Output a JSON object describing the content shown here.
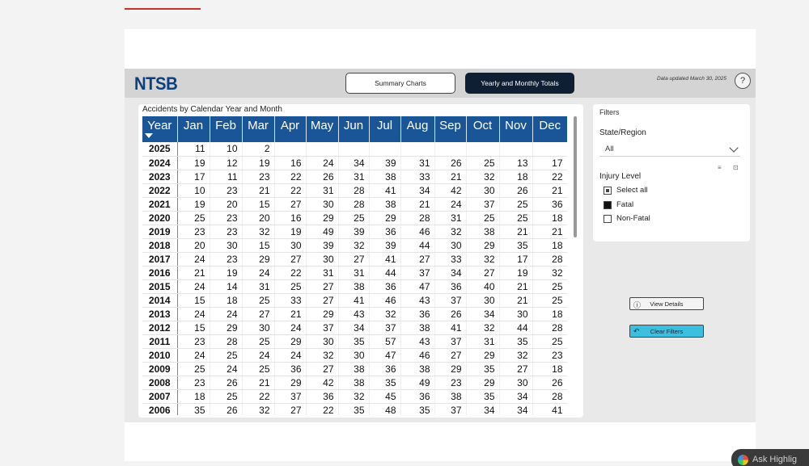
{
  "header": {
    "logo": "NTSB",
    "summary_button": "Summary Charts",
    "yearly_button": "Yearly and Monthly Totals",
    "updated_text": "Data updated March 30, 2025",
    "help_icon_glyph": "?"
  },
  "table": {
    "title": "Accidents by Calendar Year and Month",
    "columns": [
      "Year",
      "Jan",
      "Feb",
      "Mar",
      "Apr",
      "May",
      "Jun",
      "Jul",
      "Aug",
      "Sep",
      "Oct",
      "Nov",
      "Dec"
    ],
    "rows": [
      [
        "2025",
        "11",
        "10",
        "2",
        "",
        "",
        "",
        "",
        "",
        "",
        "",
        "",
        ""
      ],
      [
        "2024",
        "19",
        "12",
        "19",
        "16",
        "24",
        "34",
        "39",
        "31",
        "26",
        "25",
        "13",
        "17"
      ],
      [
        "2023",
        "17",
        "11",
        "23",
        "22",
        "26",
        "31",
        "38",
        "33",
        "21",
        "32",
        "18",
        "22"
      ],
      [
        "2022",
        "10",
        "23",
        "21",
        "22",
        "31",
        "28",
        "41",
        "34",
        "42",
        "30",
        "26",
        "21"
      ],
      [
        "2021",
        "19",
        "20",
        "15",
        "27",
        "30",
        "28",
        "38",
        "21",
        "24",
        "37",
        "25",
        "36"
      ],
      [
        "2020",
        "25",
        "23",
        "20",
        "16",
        "29",
        "25",
        "29",
        "28",
        "31",
        "25",
        "25",
        "18"
      ],
      [
        "2019",
        "23",
        "23",
        "32",
        "19",
        "49",
        "39",
        "36",
        "46",
        "32",
        "38",
        "21",
        "21"
      ],
      [
        "2018",
        "20",
        "30",
        "15",
        "30",
        "39",
        "32",
        "39",
        "44",
        "30",
        "29",
        "35",
        "18"
      ],
      [
        "2017",
        "24",
        "23",
        "29",
        "27",
        "30",
        "27",
        "41",
        "27",
        "33",
        "32",
        "17",
        "28"
      ],
      [
        "2016",
        "21",
        "19",
        "24",
        "22",
        "31",
        "31",
        "44",
        "37",
        "34",
        "27",
        "19",
        "32"
      ],
      [
        "2015",
        "24",
        "14",
        "31",
        "25",
        "27",
        "38",
        "36",
        "47",
        "36",
        "40",
        "21",
        "25"
      ],
      [
        "2014",
        "15",
        "18",
        "25",
        "33",
        "27",
        "41",
        "46",
        "43",
        "37",
        "30",
        "21",
        "25"
      ],
      [
        "2013",
        "24",
        "24",
        "27",
        "21",
        "29",
        "43",
        "32",
        "36",
        "26",
        "34",
        "30",
        "18"
      ],
      [
        "2012",
        "15",
        "29",
        "30",
        "24",
        "37",
        "34",
        "37",
        "38",
        "41",
        "32",
        "44",
        "28"
      ],
      [
        "2011",
        "23",
        "28",
        "25",
        "29",
        "30",
        "35",
        "57",
        "43",
        "37",
        "31",
        "35",
        "25"
      ],
      [
        "2010",
        "24",
        "25",
        "24",
        "24",
        "32",
        "30",
        "47",
        "46",
        "27",
        "29",
        "32",
        "23"
      ],
      [
        "2009",
        "25",
        "24",
        "25",
        "36",
        "27",
        "38",
        "36",
        "38",
        "29",
        "35",
        "27",
        "18"
      ],
      [
        "2008",
        "23",
        "26",
        "21",
        "29",
        "42",
        "38",
        "35",
        "49",
        "23",
        "29",
        "30",
        "26"
      ],
      [
        "2007",
        "18",
        "25",
        "22",
        "37",
        "36",
        "32",
        "45",
        "36",
        "38",
        "35",
        "34",
        "28"
      ],
      [
        "2006",
        "35",
        "26",
        "32",
        "27",
        "22",
        "35",
        "48",
        "35",
        "37",
        "34",
        "34",
        "41"
      ]
    ]
  },
  "filters": {
    "title": "Filters",
    "state_label": "State/Region",
    "state_value": "All",
    "injury_label": "Injury Level",
    "options": [
      {
        "label": "Select all",
        "state": "partial"
      },
      {
        "label": "Fatal",
        "state": "checked"
      },
      {
        "label": "Non-Fatal",
        "state": "unchecked"
      }
    ]
  },
  "actions": {
    "view_details": "View Details",
    "clear_filters": "Clear Filters"
  },
  "assistant": {
    "label": "Ask Highlig"
  }
}
